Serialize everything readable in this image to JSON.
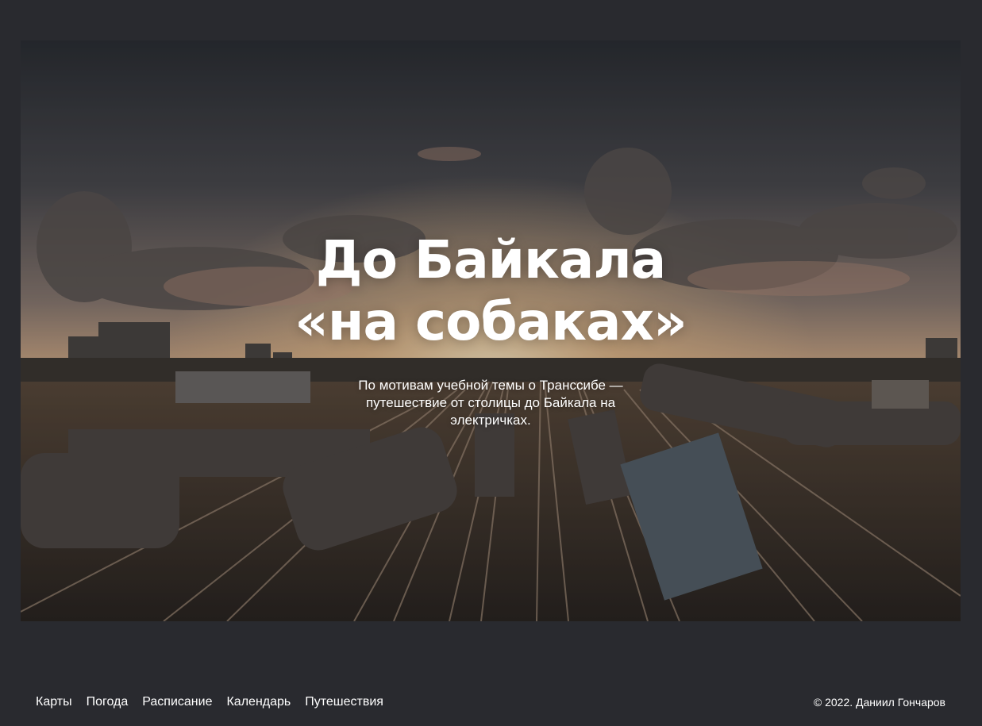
{
  "hero": {
    "title_line1": "До Байкала",
    "title_line2": "«на собаках»",
    "subtitle": "По мотивам учебной темы о Транссибе — путешествие от столицы до Байкала на электричках.",
    "image_description": "sunset-railway-yard-photo"
  },
  "footer": {
    "nav": [
      {
        "label": "Карты"
      },
      {
        "label": "Погода"
      },
      {
        "label": "Расписание"
      },
      {
        "label": "Календарь"
      },
      {
        "label": "Путешествия"
      }
    ],
    "copyright": "© 2022. Даниил Гончаров"
  },
  "colors": {
    "page_background": "#292a2f",
    "text": "#ffffff",
    "sky_top": "#2f3238",
    "horizon_glow": "#f3c894"
  }
}
